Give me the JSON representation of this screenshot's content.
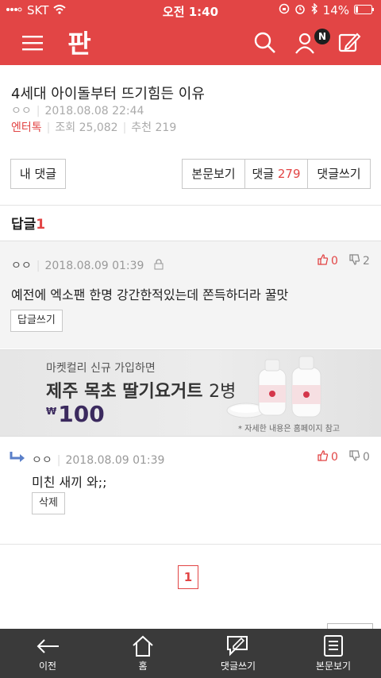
{
  "status": {
    "carrier": "SKT",
    "time": "오전 1:40",
    "battery": "14%"
  },
  "header": {
    "logo": "판",
    "notification_badge": "N",
    "accent": "#e24545"
  },
  "post": {
    "title": "4세대 아이돌부터 뜨기힘든 이유",
    "author": "ㅇㅇ",
    "date": "2018.08.08 22:44",
    "category": "엔터톡",
    "views_label": "조회",
    "views": "25,082",
    "recommend_label": "추천",
    "recommend": "219"
  },
  "actions": {
    "my_comments": "내 댓글",
    "view_body": "본문보기",
    "comments_label": "댓글",
    "comment_count": "279",
    "write_comment": "댓글쓰기"
  },
  "replies": {
    "label": "답글",
    "count": "1",
    "comment": {
      "author": "ㅇㅇ",
      "date": "2018.08.09 01:39",
      "text": "예전에 엑소팬 한명 강간한적있는데 쫀득하더라 꿀맛",
      "likes": "0",
      "dislikes": "2",
      "reply_button": "답글쓰기"
    },
    "reply": {
      "author": "ㅇㅇ",
      "date": "2018.08.09 01:39",
      "text": "미친 새끼 와;;",
      "likes": "0",
      "dislikes": "0",
      "delete_button": "삭제"
    }
  },
  "ad": {
    "line1": "마켓컬리 신규 가입하면",
    "line2_bold": "제주 목초 딸기요거트",
    "line2_light": "2병",
    "currency": "₩",
    "price": "100",
    "note": "* 자세한 내용은 홈페이지 참고"
  },
  "pagination": {
    "current": "1"
  },
  "bottom_nav": [
    {
      "label": "이전",
      "icon": "back-arrow-icon"
    },
    {
      "label": "홈",
      "icon": "home-icon"
    },
    {
      "label": "댓글쓰기",
      "icon": "comment-write-icon"
    },
    {
      "label": "본문보기",
      "icon": "document-icon"
    }
  ]
}
